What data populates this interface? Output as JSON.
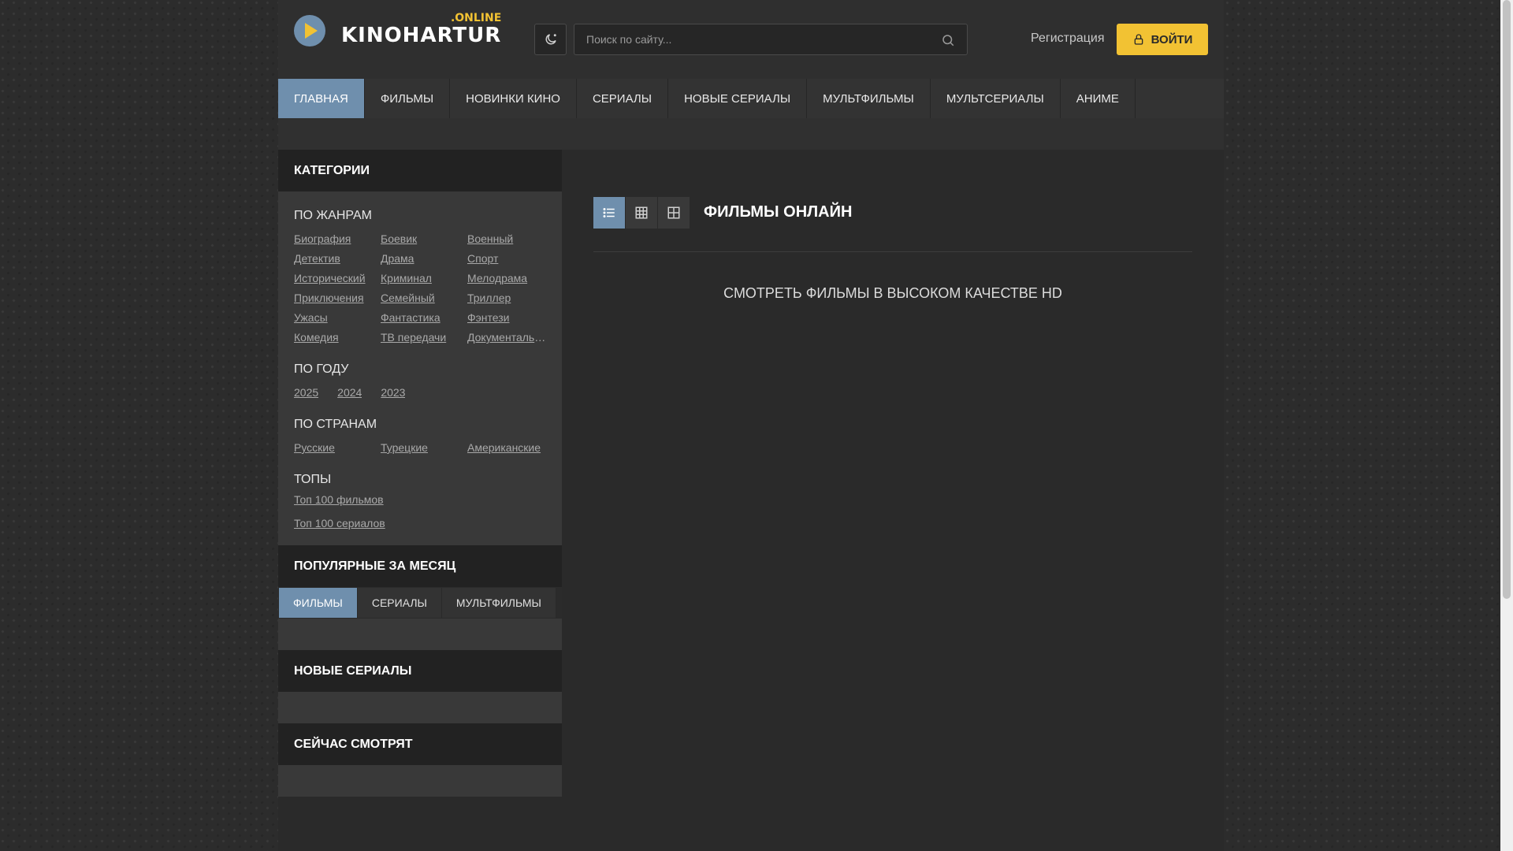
{
  "logo": {
    "main": "KINOHARTUR",
    "sub": ".ONLINE"
  },
  "search": {
    "placeholder": "Поиск по сайту..."
  },
  "header": {
    "register": "Регистрация",
    "login": "ВОЙТИ"
  },
  "nav": [
    "ГЛАВНАЯ",
    "ФИЛЬМЫ",
    "НОВИНКИ КИНО",
    "СЕРИАЛЫ",
    "НОВЫЕ СЕРИАЛЫ",
    "МУЛЬТФИЛЬМЫ",
    "МУЛЬТСЕРИАЛЫ",
    "АНИМЕ"
  ],
  "sidebar": {
    "categories_title": "КАТЕГОРИИ",
    "genres_title": "ПО ЖАНРАМ",
    "genres": [
      "Биография",
      "Боевик",
      "Военный",
      "Детектив",
      "Драма",
      "Спорт",
      "Исторический",
      "Криминал",
      "Мелодрама",
      "Приключения",
      "Семейный",
      "Триллер",
      "Ужасы",
      "Фантастика",
      "Фэнтези",
      "Комедия",
      "ТВ передачи",
      "Документальный"
    ],
    "years_title": "ПО ГОДУ",
    "years": [
      "2025",
      "2024",
      "2023"
    ],
    "countries_title": "ПО СТРАНАМ",
    "countries": [
      "Русские",
      "Турецкие",
      "Американские"
    ],
    "tops_title": "ТОПЫ",
    "tops": [
      "Топ 100 фильмов",
      "Топ 100 сериалов"
    ],
    "popular_title": "ПОПУЛЯРНЫЕ ЗА МЕСЯЦ",
    "popular_tabs": [
      "ФИЛЬМЫ",
      "СЕРИАЛЫ",
      "МУЛЬТФИЛЬМЫ"
    ],
    "new_series_title": "НОВЫЕ СЕРИАЛЫ",
    "watching_title": "СЕЙЧАС СМОТРЯТ"
  },
  "main": {
    "title": "ФИЛЬМЫ ОНЛАЙН",
    "subtitle": "СМОТРЕТЬ ФИЛЬМЫ В ВЫСОКОМ КАЧЕСТВЕ HD"
  },
  "colors": {
    "accent": "#6f8fad",
    "brand": "#f2c233"
  }
}
